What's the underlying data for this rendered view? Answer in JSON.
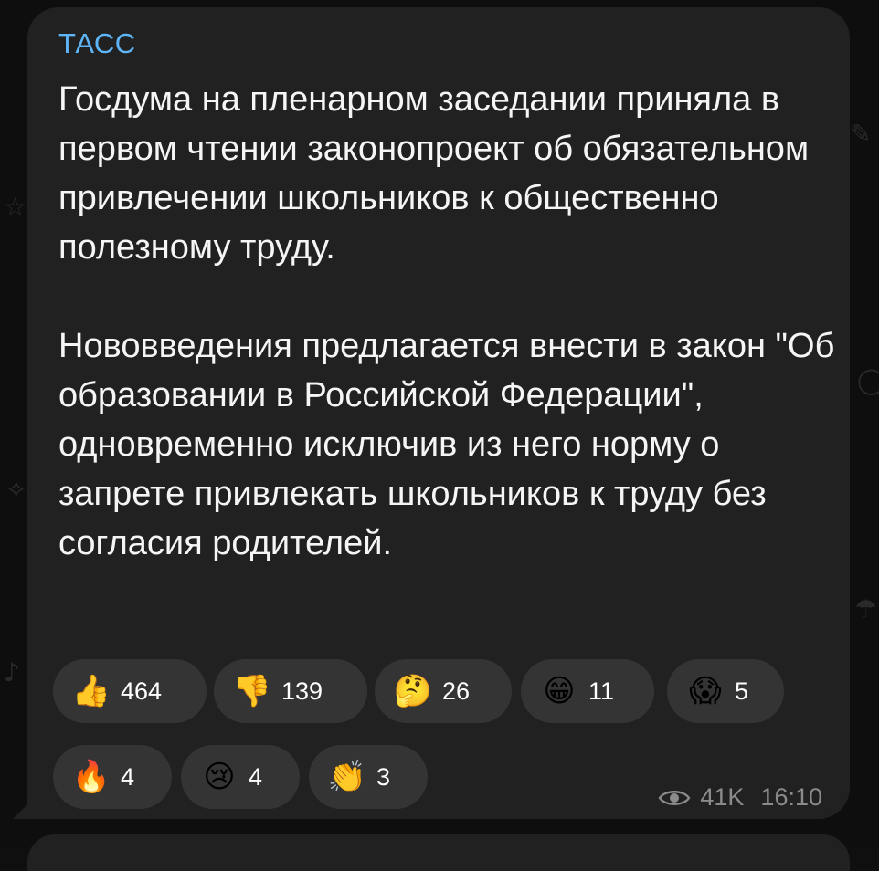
{
  "message": {
    "sender": "ТАСС",
    "paragraphs": [
      "Госдума на пленарном заседании приняла в первом чтении законопроект об обязательном привлечении школьников к общественно полезному труду.",
      "Нововведения предлагается внести в закон \"Об образовании в Российской Федерации\", одновременно исключив из него норму о запрете привлекать школьников к труду без согласия родителей."
    ],
    "views": "41K",
    "time": "16:10"
  },
  "reactions": [
    {
      "emoji": "👍",
      "icon": "thumbs-up-icon",
      "count": "464"
    },
    {
      "emoji": "👎",
      "icon": "thumbs-down-icon",
      "count": "139"
    },
    {
      "emoji": "🤔",
      "icon": "thinking-face-icon",
      "count": "26"
    },
    {
      "emoji": "😁",
      "icon": "grinning-face-icon",
      "count": "11"
    },
    {
      "emoji": "😱",
      "icon": "screaming-face-icon",
      "count": "5"
    },
    {
      "emoji": "🔥",
      "icon": "fire-icon",
      "count": "4"
    },
    {
      "emoji": "😢",
      "icon": "crying-face-icon",
      "count": "4"
    },
    {
      "emoji": "👏",
      "icon": "clapping-hands-icon",
      "count": "3"
    }
  ],
  "colors": {
    "background": "#0e0e0e",
    "bubble": "#212121",
    "sender": "#5eb5f7",
    "text": "#f5f5f5",
    "reaction_chip": "#343434",
    "meta": "#8b8b8b"
  }
}
